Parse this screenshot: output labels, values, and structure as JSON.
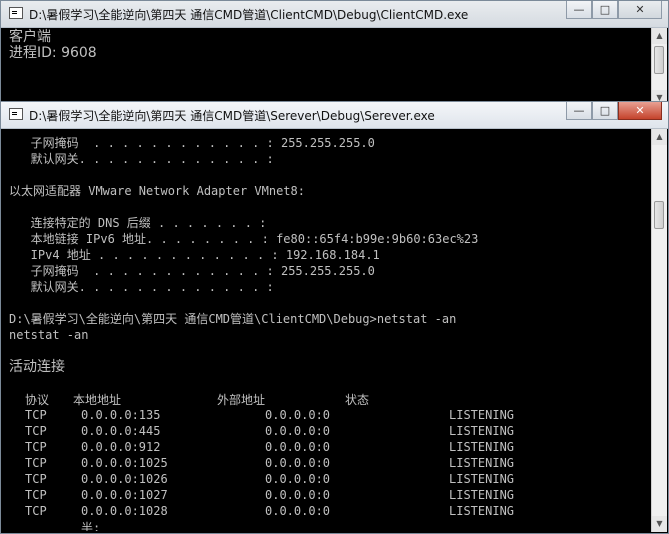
{
  "client": {
    "title": "D:\\暑假学习\\全能逆向\\第四天 通信CMD管道\\ClientCMD\\Debug\\ClientCMD.exe",
    "lines": [
      "客户端",
      "进程ID: 9608"
    ],
    "controls": {
      "minimize": "—",
      "maximize": "□",
      "close": "✕"
    }
  },
  "server": {
    "title": "D:\\暑假学习\\全能逆向\\第四天 通信CMD管道\\Serever\\Debug\\Serever.exe",
    "controls": {
      "minimize": "—",
      "maximize": "□",
      "close": "✕"
    },
    "lines": [
      "   子网掩码  . . . . . . . . . . . . : 255.255.255.0",
      "   默认网关. . . . . . . . . . . . . :",
      "",
      "以太网适配器 VMware Network Adapter VMnet8:",
      "",
      "   连接特定的 DNS 后缀 . . . . . . . :",
      "   本地链接 IPv6 地址. . . . . . . . : fe80::65f4:b99e:9b60:63ec%23",
      "   IPv4 地址 . . . . . . . . . . . . : 192.168.184.1",
      "   子网掩码  . . . . . . . . . . . . : 255.255.255.0",
      "   默认网关. . . . . . . . . . . . . :",
      "",
      "D:\\暑假学习\\全能逆向\\第四天 通信CMD管道\\ClientCMD\\Debug>netstat -an",
      "netstat -an",
      "",
      "活动连接"
    ],
    "netstat": {
      "headers": [
        "协议",
        "本地地址",
        "外部地址",
        "状态"
      ],
      "rows": [
        [
          "TCP",
          "0.0.0.0:135",
          "0.0.0.0:0",
          "LISTENING"
        ],
        [
          "TCP",
          "0.0.0.0:445",
          "0.0.0.0:0",
          "LISTENING"
        ],
        [
          "TCP",
          "0.0.0.0:912",
          "0.0.0.0:0",
          "LISTENING"
        ],
        [
          "TCP",
          "0.0.0.0:1025",
          "0.0.0.0:0",
          "LISTENING"
        ],
        [
          "TCP",
          "0.0.0.0:1026",
          "0.0.0.0:0",
          "LISTENING"
        ],
        [
          "TCP",
          "0.0.0.0:1027",
          "0.0.0.0:0",
          "LISTENING"
        ],
        [
          "TCP",
          "0.0.0.0:1028",
          "0.0.0.0:0",
          "LISTENING"
        ]
      ],
      "trailing": "半:"
    }
  }
}
